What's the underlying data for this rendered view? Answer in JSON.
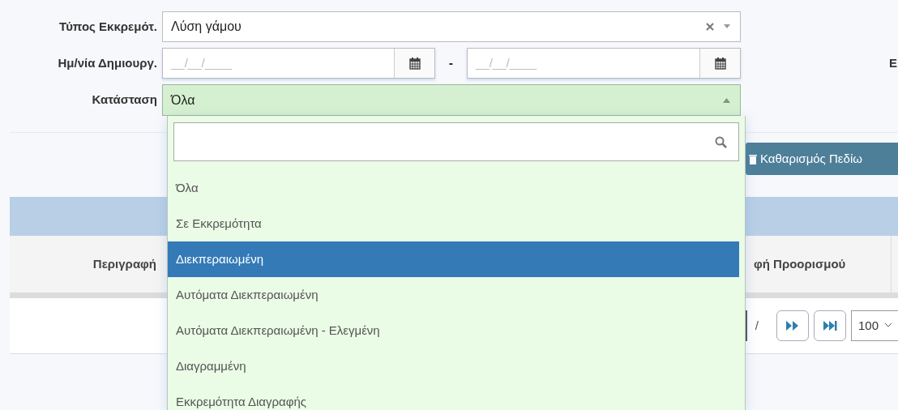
{
  "filters": {
    "pending_type": {
      "label": "Τύπος Εκκρεμότ.",
      "value": "Λύση γάμου"
    },
    "created_date": {
      "label": "Ημ/νία Δημιουργ.",
      "from_placeholder": "__/__/____",
      "separator": "-",
      "to_placeholder": "__/__/____"
    },
    "right_label_cut": "Ε",
    "status": {
      "label": "Κατάσταση",
      "value": "Όλα",
      "expanded": true,
      "options": [
        {
          "label": "Όλα",
          "highlighted": false
        },
        {
          "label": "Σε Εκκρεμότητα",
          "highlighted": false
        },
        {
          "label": "Διεκπεραιωμένη",
          "highlighted": true
        },
        {
          "label": "Αυτόματα Διεκπεραιωμένη",
          "highlighted": false
        },
        {
          "label": "Αυτόματα Διεκπεραιωμένη - Ελεγμένη",
          "highlighted": false
        },
        {
          "label": "Διαγραμμένη",
          "highlighted": false
        },
        {
          "label": "Εκκρεμότητα Διαγραφής",
          "highlighted": false
        }
      ]
    }
  },
  "clear_fields_button": "Καθαρισμός Πεδίω",
  "table": {
    "columns": [
      "Περιγραφή",
      "φή Προορισμού"
    ]
  },
  "pager": {
    "separator": "/",
    "page_size": "100"
  }
}
